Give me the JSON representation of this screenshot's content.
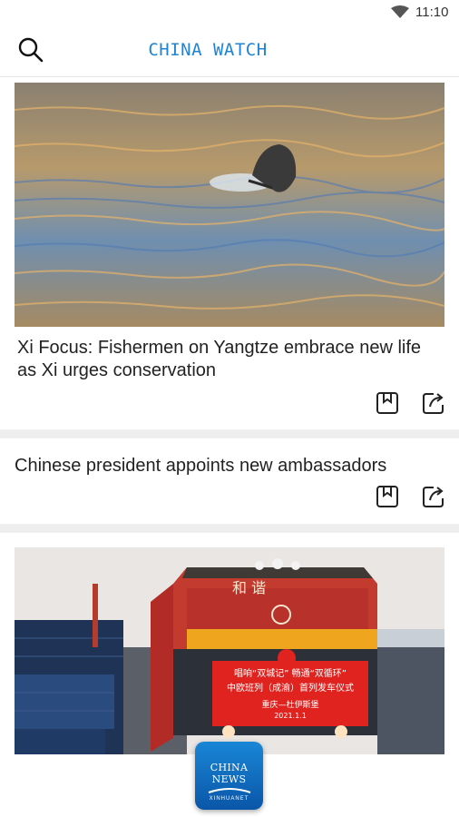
{
  "status_bar": {
    "time": "11:10"
  },
  "app_bar": {
    "title": "CHINA WATCH"
  },
  "articles": [
    {
      "title": "Xi Focus: Fishermen on Yangtze embrace new life as Xi urges conservation"
    },
    {
      "title": "Chinese president appoints new ambassadors"
    },
    {
      "title": "",
      "image_text": {
        "locomotive_chars": "和  谐",
        "banner_line1": "唱响“双城记” 畅通“双循环”",
        "banner_line2": "中欧班列（成渝）首列发车仪式",
        "banner_line3": "重庆—杜伊斯堡",
        "banner_date": "2021.1.1"
      }
    }
  ],
  "badge": {
    "name": "CHINA NEWS",
    "sub": "XINHUANET"
  },
  "colors": {
    "accent": "#1f84d6",
    "divider": "#eeeeee",
    "banner_red": "#e0231f"
  },
  "icons": [
    "wifi-icon",
    "search-icon",
    "bookmark-icon",
    "share-icon"
  ]
}
